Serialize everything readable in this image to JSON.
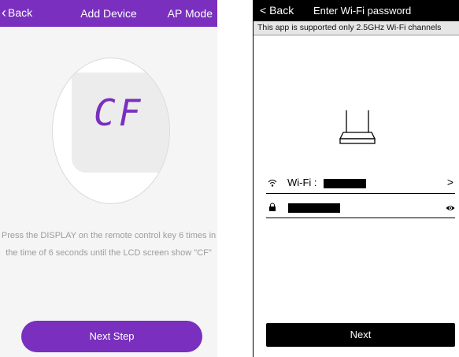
{
  "left_screen": {
    "nav": {
      "back_label": "Back",
      "title": "Add Device",
      "right_label": "AP Mode"
    },
    "display_code": "CF",
    "instruction_line1": "Press the DISPLAY on the remote control key 6 times in",
    "instruction_line2": "the time of 6 seconds until the LCD screen show \"CF\"",
    "next_button": "Next Step"
  },
  "right_screen": {
    "nav": {
      "back_label": "Back",
      "title": "Enter Wi-Fi password"
    },
    "banner": "This app is supported only 2.5GHz Wi-Fi channels",
    "wifi_label": "Wi-Fi :",
    "next_button": "Next"
  },
  "colors": {
    "accent": "#7a2fbe",
    "right_nav": "#000000"
  }
}
